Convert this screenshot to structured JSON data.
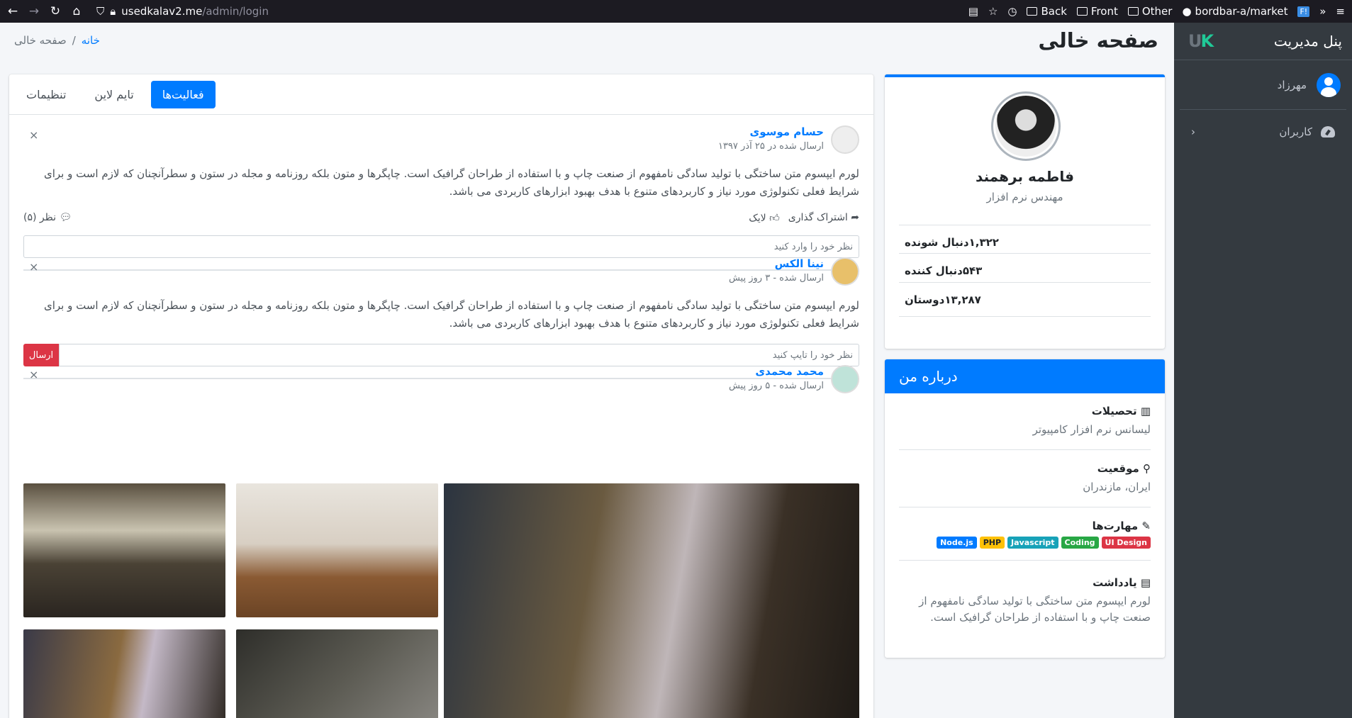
{
  "browser": {
    "url_host": "usedkalav2.me",
    "url_path": "/admin/login",
    "bookmarks": [
      "Back",
      "Front",
      "Other",
      "bordbar-a/market"
    ],
    "ext_label": "F!"
  },
  "sidebar": {
    "brand": "پنل مدیریت",
    "logo_u": "U",
    "logo_k": "K",
    "user": "مهرزاد",
    "menu": [
      {
        "label": "کاربران"
      }
    ]
  },
  "header": {
    "title": "صفحه خالی",
    "breadcrumb_home": "خانه",
    "breadcrumb_sep": "/",
    "breadcrumb_current": "صفحه خالی"
  },
  "profile": {
    "name": "فاطمه برهمند",
    "role": "مهندس نرم افزار",
    "stats": [
      {
        "label": "دنبال شونده",
        "value": "۱,۳۲۲"
      },
      {
        "label": "دنبال کننده",
        "value": "۵۴۳"
      },
      {
        "label": "دوستان",
        "value": "۱۳,۲۸۷"
      }
    ]
  },
  "about": {
    "title": "درباره من",
    "education_title": "تحصیلات",
    "education": "لیسانس نرم افزار کامپیوتر",
    "location_title": "موقعیت",
    "location": "ایران، مازندران",
    "skills_title": "مهارت‌ها",
    "skills": [
      {
        "label": "UI Design",
        "color": "#dc3545"
      },
      {
        "label": "Coding",
        "color": "#28a745"
      },
      {
        "label": "Javascript",
        "color": "#17a2b8"
      },
      {
        "label": "PHP",
        "color": "#ffc107"
      },
      {
        "label": "Node.js",
        "color": "#007bff"
      }
    ],
    "notes_title": "یادداشت",
    "notes": "لورم ایپسوم متن ساختگی با تولید سادگی نامفهوم از صنعت چاپ و با استفاده از طراحان گرافیک است."
  },
  "tabs": [
    "فعالیت‌ها",
    "تایم لاین",
    "تنظیمات"
  ],
  "posts": [
    {
      "user": "حسام موسوی",
      "date": "ارسال شده در ۲۵ آذر ۱۳۹۷",
      "body": "لورم ایپسوم متن ساختگی با تولید سادگی نامفهوم از صنعت چاپ و با استفاده از طراحان گرافیک است. چاپگرها و متون بلکه روزنامه و مجله در ستون و سطرآنچنان که لازم است و برای شرایط فعلی تکنولوژی مورد نیاز و کاربردهای متنوع با هدف بهبود ابزارهای کاربردی می باشد.",
      "share": "اشتراک گذاری",
      "like": "لایک",
      "comments": "نظر (۵)",
      "input_placeholder": "نظر خود را وارد کنید"
    },
    {
      "user": "نینا الکس",
      "date": "ارسال شده - ۳ روز پیش",
      "body": "لورم ایپسوم متن ساختگی با تولید سادگی نامفهوم از صنعت چاپ و با استفاده از طراحان گرافیک است. چاپگرها و متون بلکه روزنامه و مجله در ستون و سطرآنچنان که لازم است و برای شرایط فعلی تکنولوژی مورد نیاز و کاربردهای متنوع با هدف بهبود ابزارهای کاربردی می باشد.",
      "input_placeholder": "نظر خود را تایپ کنید",
      "send": "ارسال"
    },
    {
      "user": "محمد محمدی",
      "date": "ارسال شده - ۵ روز پیش"
    }
  ],
  "close_glyph": "×"
}
